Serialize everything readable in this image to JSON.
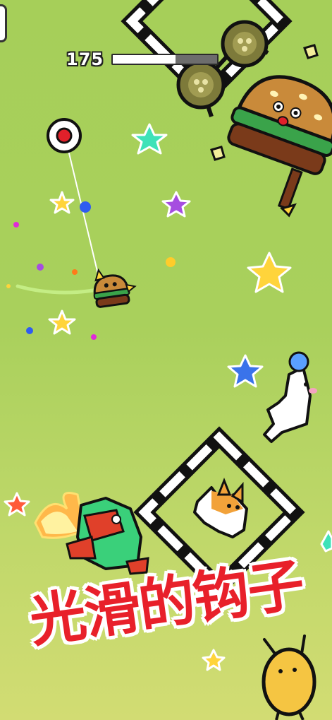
{
  "hud": {
    "score": "175",
    "progress_fraction": 0.6
  },
  "caption": "光滑的钩子",
  "colors": {
    "background_top": "#a6cf59",
    "background_bottom": "#d2dc73",
    "caption_red": "#e8202a",
    "hook_red": "#e0202a",
    "star_gold": "#ffd43b",
    "star_teal": "#3ee2b8",
    "star_purple": "#a64de0",
    "star_blue": "#3a73ea"
  },
  "icons": [
    "pause-icon",
    "anchor-hook-icon",
    "star-icon"
  ],
  "characters": [
    "burger-player",
    "burger-monster-boss",
    "corgi-dog",
    "alpaca",
    "green-dragon",
    "potato-creature"
  ]
}
